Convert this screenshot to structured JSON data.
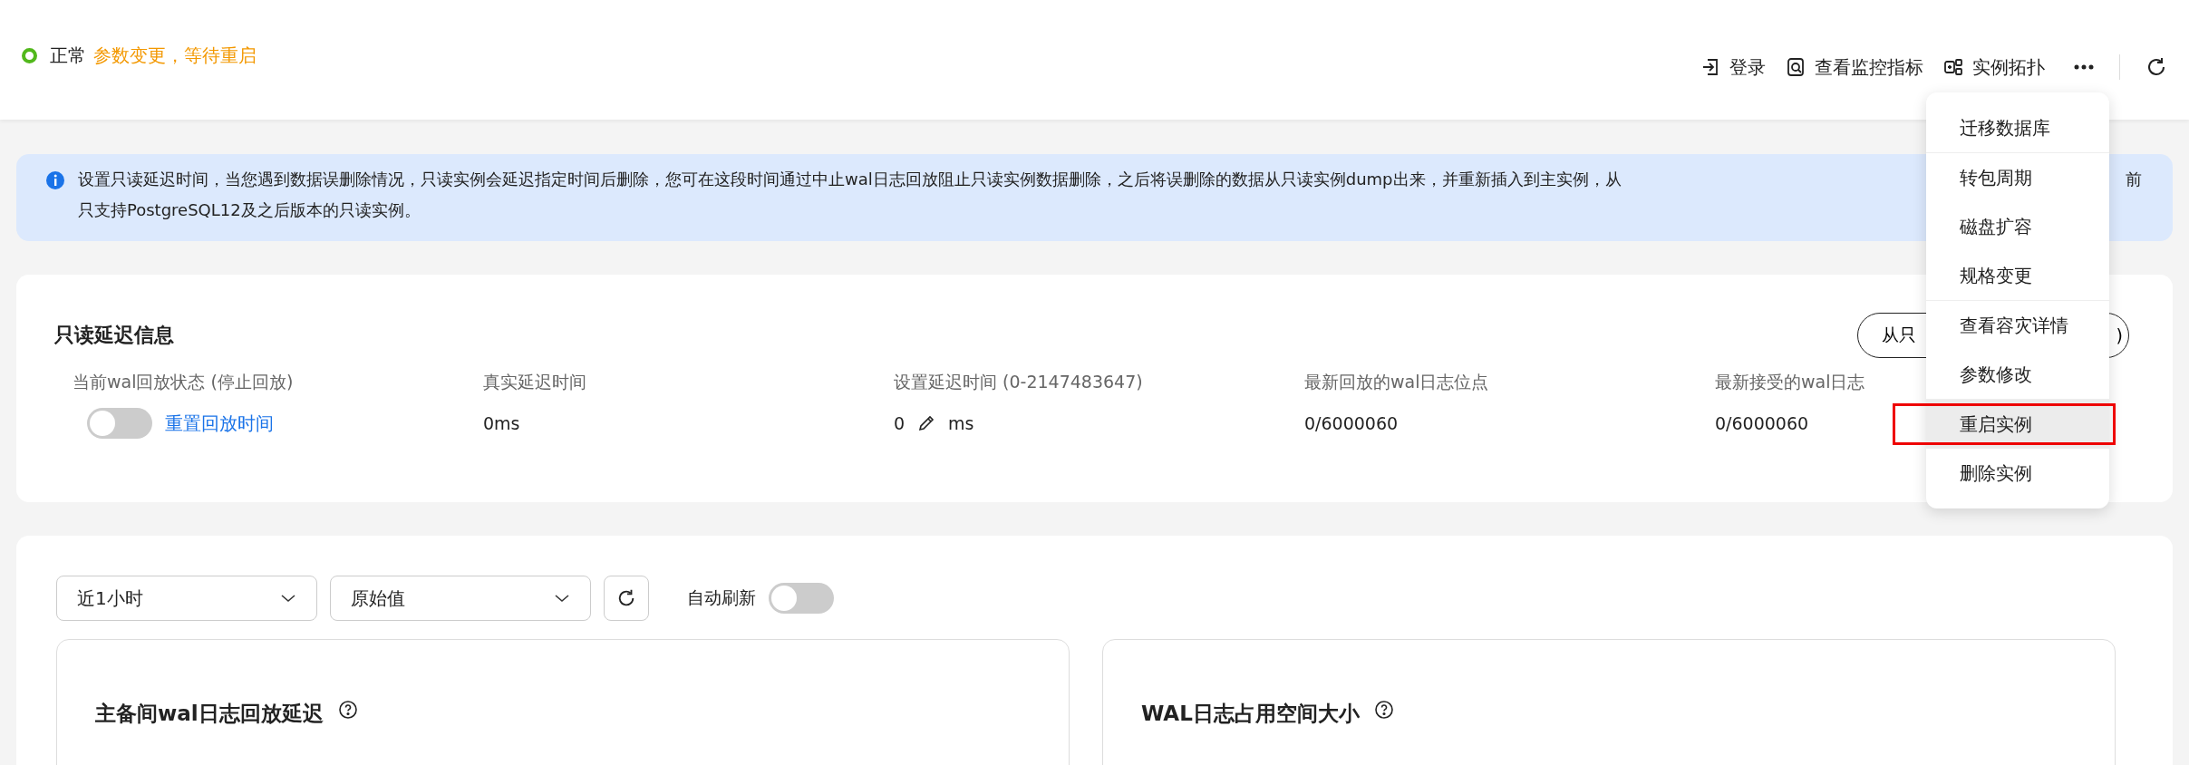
{
  "header": {
    "status": {
      "label": "正常",
      "color": "#52b81c"
    },
    "notice": "参数变更，等待重启",
    "actions": [
      {
        "kind": "login",
        "label": "登录"
      },
      {
        "kind": "monitor",
        "label": "查看监控指标"
      },
      {
        "kind": "topology",
        "label": "实例拓扑"
      }
    ],
    "more": true
  },
  "banner": {
    "text_left": "设置只读延迟时间，当您遇到数据误删除情况，只读实例会延迟指定时间后删除，您可在这段时间通过中止wal日志回放阻止只读实例数据删除，之后将误删除的数据从只读实例dump出来，并重新插入到主实例，从",
    "text_right": "前",
    "text_line2": "只支持PostgreSQL12及之后版本的只读实例。"
  },
  "delay_info": {
    "title": "只读延迟信息",
    "button_left": "从只",
    "button_right": ")",
    "fields": [
      {
        "kind": "toggle",
        "label": "当前wal回放状态 (停止回放)",
        "on": false,
        "link": "重置回放时间"
      },
      {
        "kind": "text",
        "label": "真实延迟时间",
        "value": "0ms"
      },
      {
        "kind": "edit",
        "label": "设置延迟时间 (0-2147483647)",
        "value": "0",
        "unit": "ms"
      },
      {
        "kind": "text",
        "label": "最新回放的wal日志位点",
        "value": "0/6000060"
      },
      {
        "kind": "text",
        "label": "最新接受的wal日志",
        "value": "0/6000060"
      }
    ]
  },
  "monitor": {
    "period": "近1小时",
    "mode": "原始值",
    "auto_refresh": {
      "label": "自动刷新",
      "on": false
    },
    "charts": [
      {
        "title": "主备间wal日志回放延迟"
      },
      {
        "title": "WAL日志占用空间大小"
      }
    ]
  },
  "menu": {
    "groups": [
      [
        {
          "label": "迁移数据库",
          "selected": false,
          "outlined": false
        }
      ],
      [
        {
          "label": "转包周期",
          "selected": false,
          "outlined": false
        },
        {
          "label": "磁盘扩容",
          "selected": false,
          "outlined": false
        },
        {
          "label": "规格变更",
          "selected": false,
          "outlined": false
        }
      ],
      [
        {
          "label": "查看容灾详情",
          "selected": false,
          "outlined": false
        },
        {
          "label": "参数修改",
          "selected": false,
          "outlined": false
        }
      ],
      [
        {
          "label": "重启实例",
          "selected": true,
          "outlined": true
        },
        {
          "label": "删除实例",
          "selected": false,
          "outlined": false
        }
      ]
    ]
  }
}
